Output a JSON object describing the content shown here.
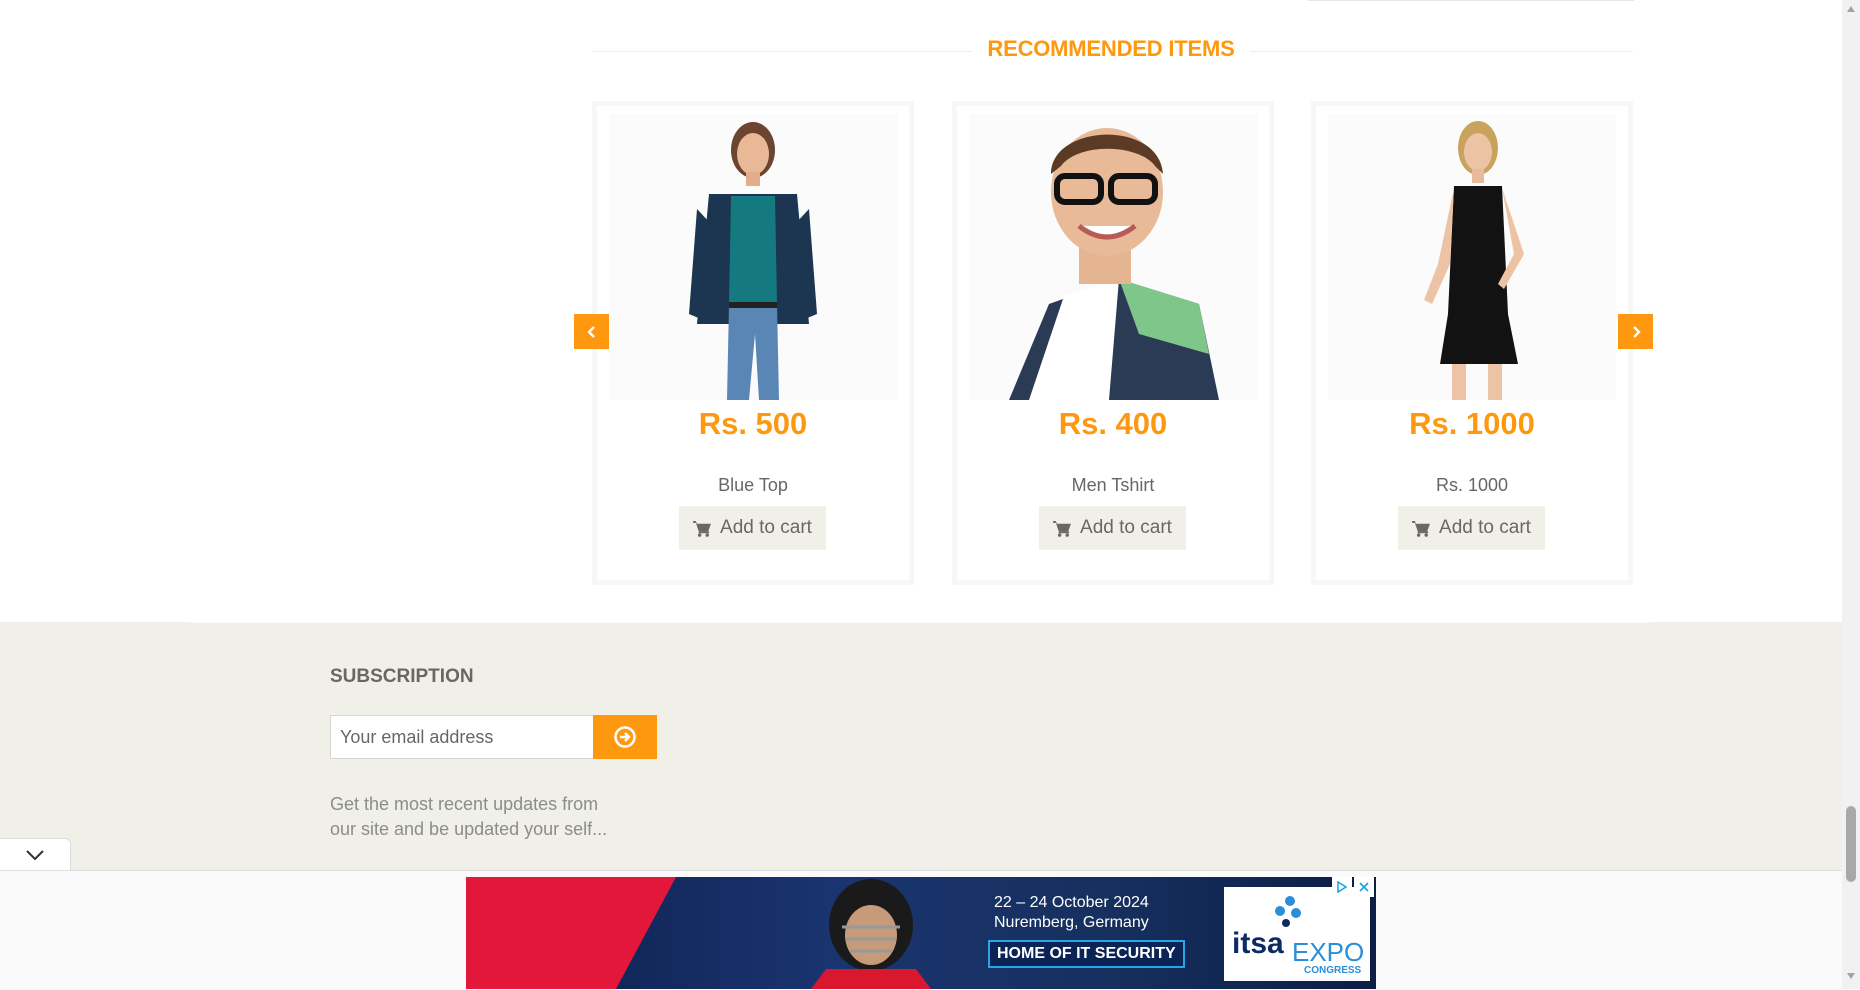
{
  "recommended": {
    "title": "RECOMMENDED ITEMS",
    "items": [
      {
        "price": "Rs. 500",
        "name": "Blue Top",
        "button": "Add to cart"
      },
      {
        "price": "Rs. 400",
        "name": "Men Tshirt",
        "button": "Add to cart"
      },
      {
        "price": "Rs. 1000",
        "name": "Rs. 1000",
        "button": "Add to cart"
      }
    ]
  },
  "subscription": {
    "title": "SUBSCRIPTION",
    "placeholder": "Your email address",
    "description": "Get the most recent updates from our site and be updated your self..."
  },
  "ad": {
    "date_line1": "22 – 24 October 2024",
    "date_line2": "Nuremberg, Germany",
    "tagline": "HOME OF IT SECURITY",
    "logo_main": "itsa",
    "logo_expo": "EXPO",
    "logo_sub": "CONGRESS"
  },
  "colors": {
    "accent": "#FE980F",
    "footer_bg": "#F0F0E9",
    "text": "#696763"
  }
}
